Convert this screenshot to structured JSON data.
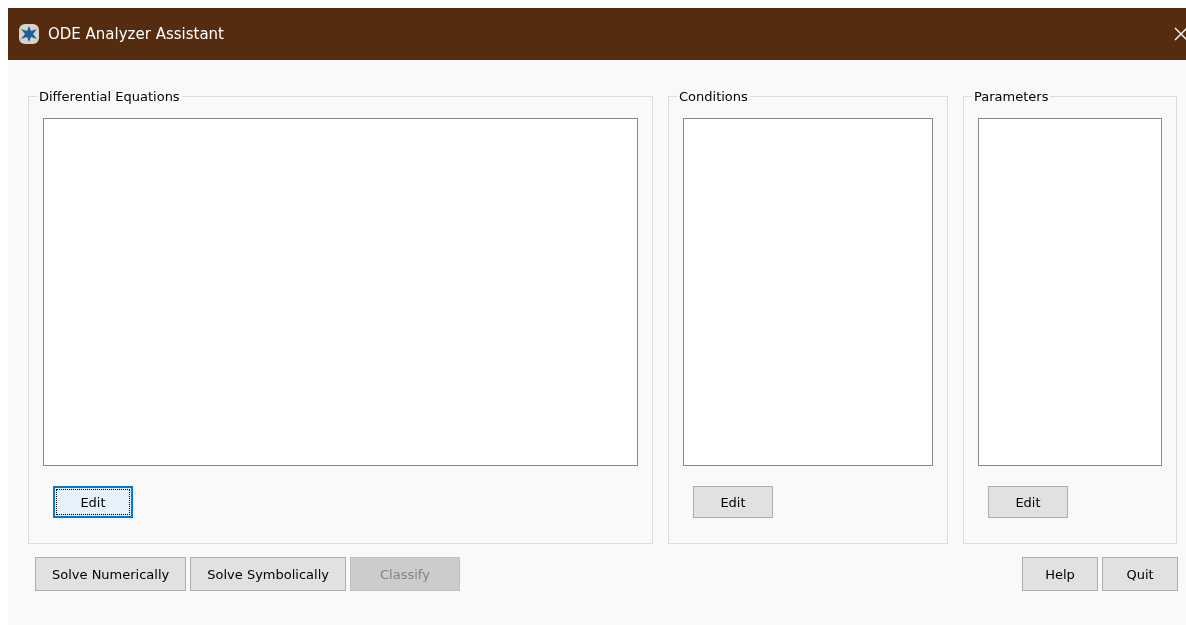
{
  "window": {
    "title": "ODE Analyzer Assistant"
  },
  "groups": [
    {
      "title": "Differential Equations",
      "edit_button": {
        "label": "Edit",
        "focused": true
      }
    },
    {
      "title": "Conditions",
      "edit_button": {
        "label": "Edit",
        "focused": false
      }
    },
    {
      "title": "Parameters",
      "edit_button": {
        "label": "Edit",
        "focused": false
      }
    }
  ],
  "buttons_left": [
    {
      "label": "Solve Numerically",
      "disabled": false
    },
    {
      "label": "Solve Symbolically",
      "disabled": false
    },
    {
      "label": "Classify",
      "disabled": true
    }
  ],
  "buttons_right": [
    {
      "label": "Help",
      "disabled": false
    },
    {
      "label": "Quit",
      "disabled": false
    }
  ]
}
